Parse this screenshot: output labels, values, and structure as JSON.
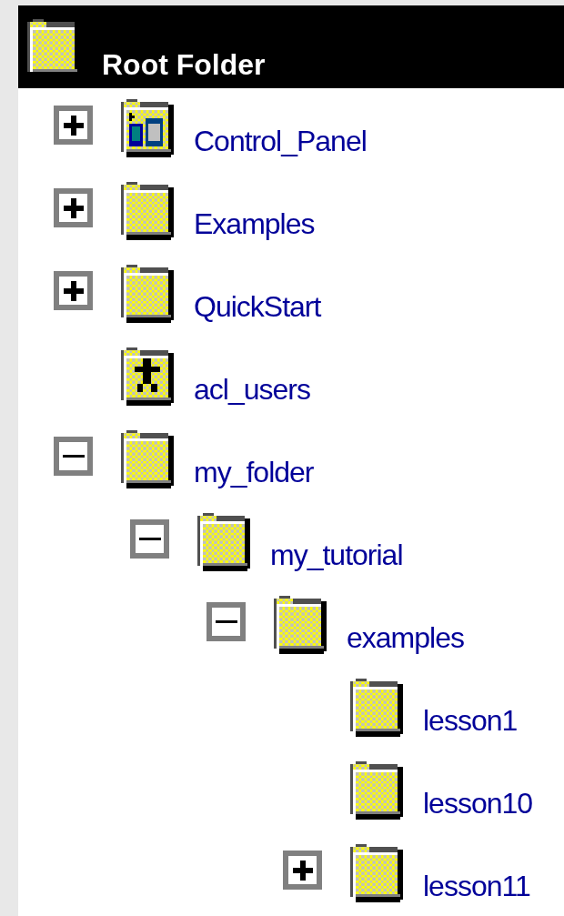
{
  "header": {
    "title": "Root Folder"
  },
  "tree": [
    {
      "name": "Control_Panel",
      "kind": "control-panel",
      "expanded": false
    },
    {
      "name": "Examples",
      "kind": "folder",
      "expanded": false
    },
    {
      "name": "QuickStart",
      "kind": "folder",
      "expanded": false
    },
    {
      "name": "acl_users",
      "kind": "users"
    },
    {
      "name": "my_folder",
      "kind": "folder",
      "expanded": true,
      "children": [
        {
          "name": "my_tutorial",
          "kind": "folder",
          "expanded": true,
          "children": [
            {
              "name": "examples",
              "kind": "folder",
              "expanded": true,
              "children": [
                {
                  "name": "lesson1",
                  "kind": "folder"
                },
                {
                  "name": "lesson10",
                  "kind": "folder"
                },
                {
                  "name": "lesson11",
                  "kind": "folder",
                  "expanded": false
                }
              ]
            }
          ]
        }
      ]
    }
  ]
}
